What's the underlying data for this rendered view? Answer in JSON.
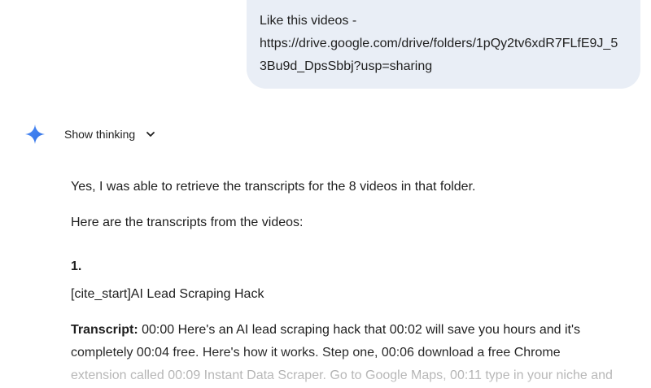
{
  "user_message": {
    "lines": [
      "Like this videos -",
      "https://drive.google.com/drive/folders/1pQy2tv6xdR7FLfE9J_5",
      "3Bu9d_DpsSbbj?usp=sharing"
    ]
  },
  "assistant": {
    "icon": "gemini-sparkle-icon",
    "show_thinking_label": "Show thinking",
    "paragraph_1": "Yes, I was able to retrieve the transcripts for the 8 videos in that folder.",
    "paragraph_2": "Here are the transcripts from the videos:",
    "item_number": "1.",
    "item_title": "[cite_start]AI Lead Scraping Hack",
    "transcript_label": "Transcript:",
    "transcript_lines": [
      " 00:00 Here's an AI lead scraping hack that 00:02 will save you hours and it's",
      "completely 00:04 free. Here's how it works. Step one, 00:06 download a free Chrome",
      "extension called 00:09 Instant Data Scraper. Go to Google Maps, 00:11 type in your niche and"
    ]
  },
  "colors": {
    "bubble_bg": "#e9eef6",
    "text": "#1f1f1f",
    "gemini_blue": "#4285f4"
  }
}
